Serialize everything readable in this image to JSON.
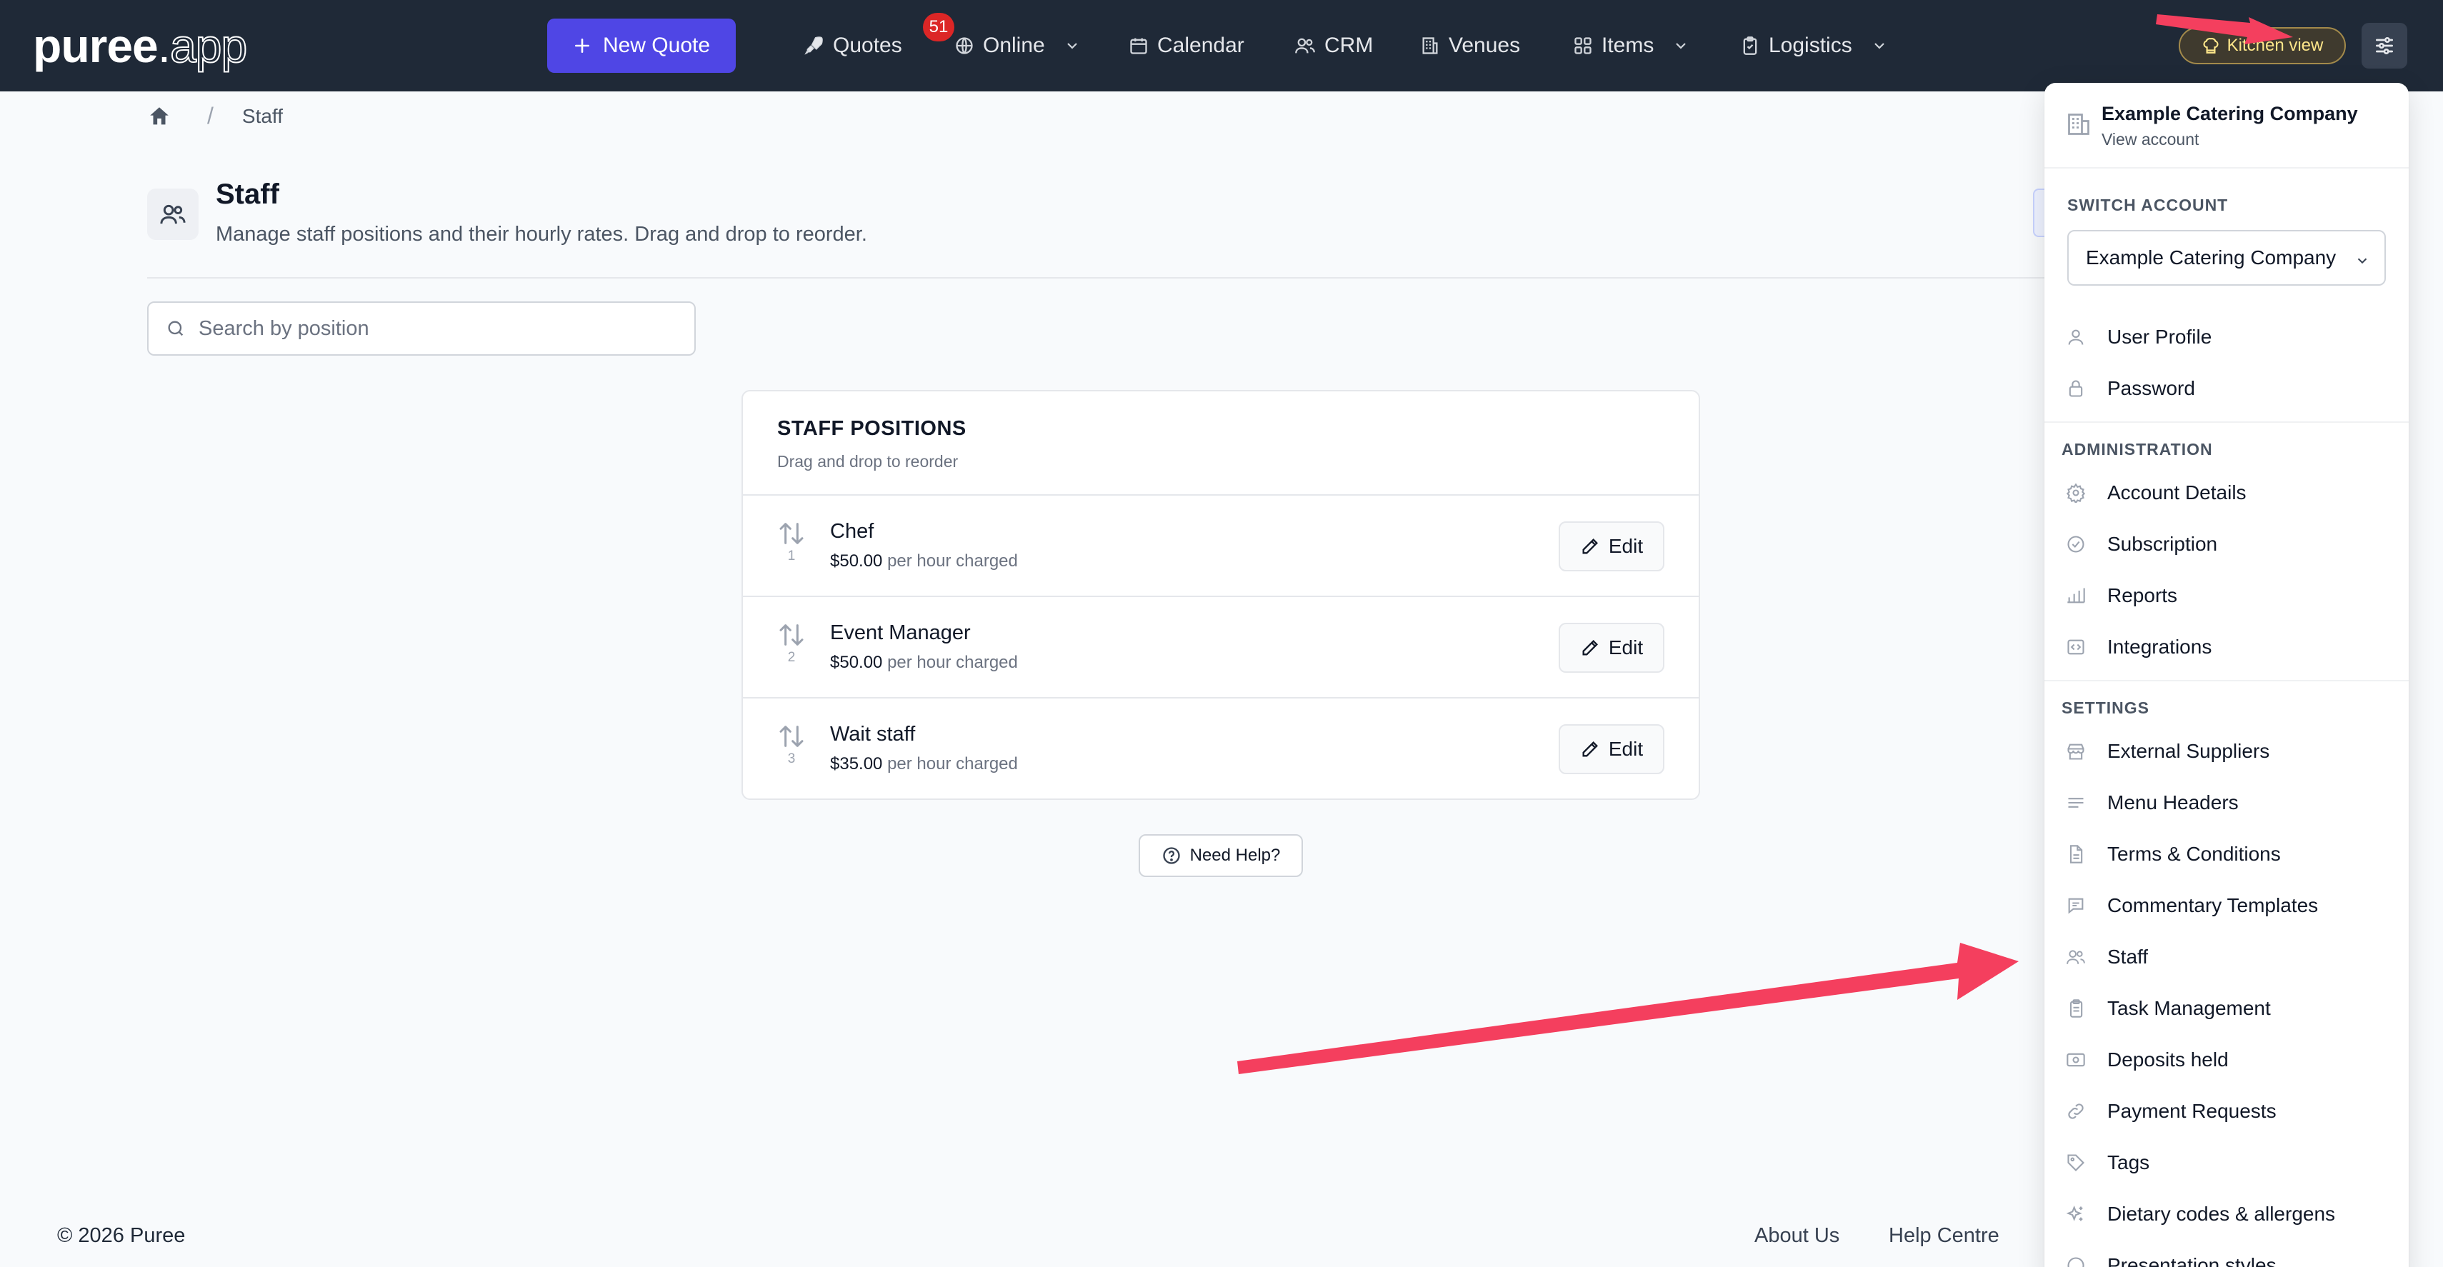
{
  "app": {
    "logo_main": "puree",
    "logo_dot": ".",
    "logo_tld": "app"
  },
  "nav": {
    "new_quote": "New Quote",
    "quotes": "Quotes",
    "quotes_badge": "51",
    "online": "Online",
    "calendar": "Calendar",
    "crm": "CRM",
    "venues": "Venues",
    "items": "Items",
    "logistics": "Logistics",
    "kitchen_view": "Kitchen view"
  },
  "breadcrumb": {
    "separator": "/",
    "current": "Staff"
  },
  "page": {
    "title": "Staff",
    "description": "Manage staff positions and their hourly rates. Drag and drop to reorder."
  },
  "search": {
    "placeholder": "Search by position",
    "value": ""
  },
  "positions": {
    "title": "STAFF POSITIONS",
    "subtitle": "Drag and drop to reorder",
    "edit_label": "Edit",
    "items": [
      {
        "order": "1",
        "name": "Chef",
        "rate": "$50.00",
        "rate_suffix": "per hour charged"
      },
      {
        "order": "2",
        "name": "Event Manager",
        "rate": "$50.00",
        "rate_suffix": "per hour charged"
      },
      {
        "order": "3",
        "name": "Wait staff",
        "rate": "$35.00",
        "rate_suffix": "per hour charged"
      }
    ]
  },
  "help": {
    "label": "Need Help?"
  },
  "footer": {
    "copyright": "© 2026 Puree",
    "about": "About Us",
    "help_centre": "Help Centre"
  },
  "menu": {
    "account_name": "Example Catering Company",
    "view_account": "View account",
    "switch_account_label": "SWITCH ACCOUNT",
    "switch_account_value": "Example Catering Company",
    "user_profile": "User Profile",
    "password": "Password",
    "administration_label": "ADMINISTRATION",
    "account_details": "Account Details",
    "subscription": "Subscription",
    "reports": "Reports",
    "integrations": "Integrations",
    "settings_label": "SETTINGS",
    "external_suppliers": "External Suppliers",
    "menu_headers": "Menu Headers",
    "terms": "Terms & Conditions",
    "commentary": "Commentary Templates",
    "staff": "Staff",
    "task_management": "Task Management",
    "deposits_held": "Deposits held",
    "payment_requests": "Payment Requests",
    "tags": "Tags",
    "dietary": "Dietary codes & allergens",
    "presentation": "Presentation styles"
  },
  "colors": {
    "nav_bg": "#1f2937",
    "primary": "#4f46e5",
    "badge": "#dc2626",
    "annotation_arrow": "#f43f5e"
  }
}
